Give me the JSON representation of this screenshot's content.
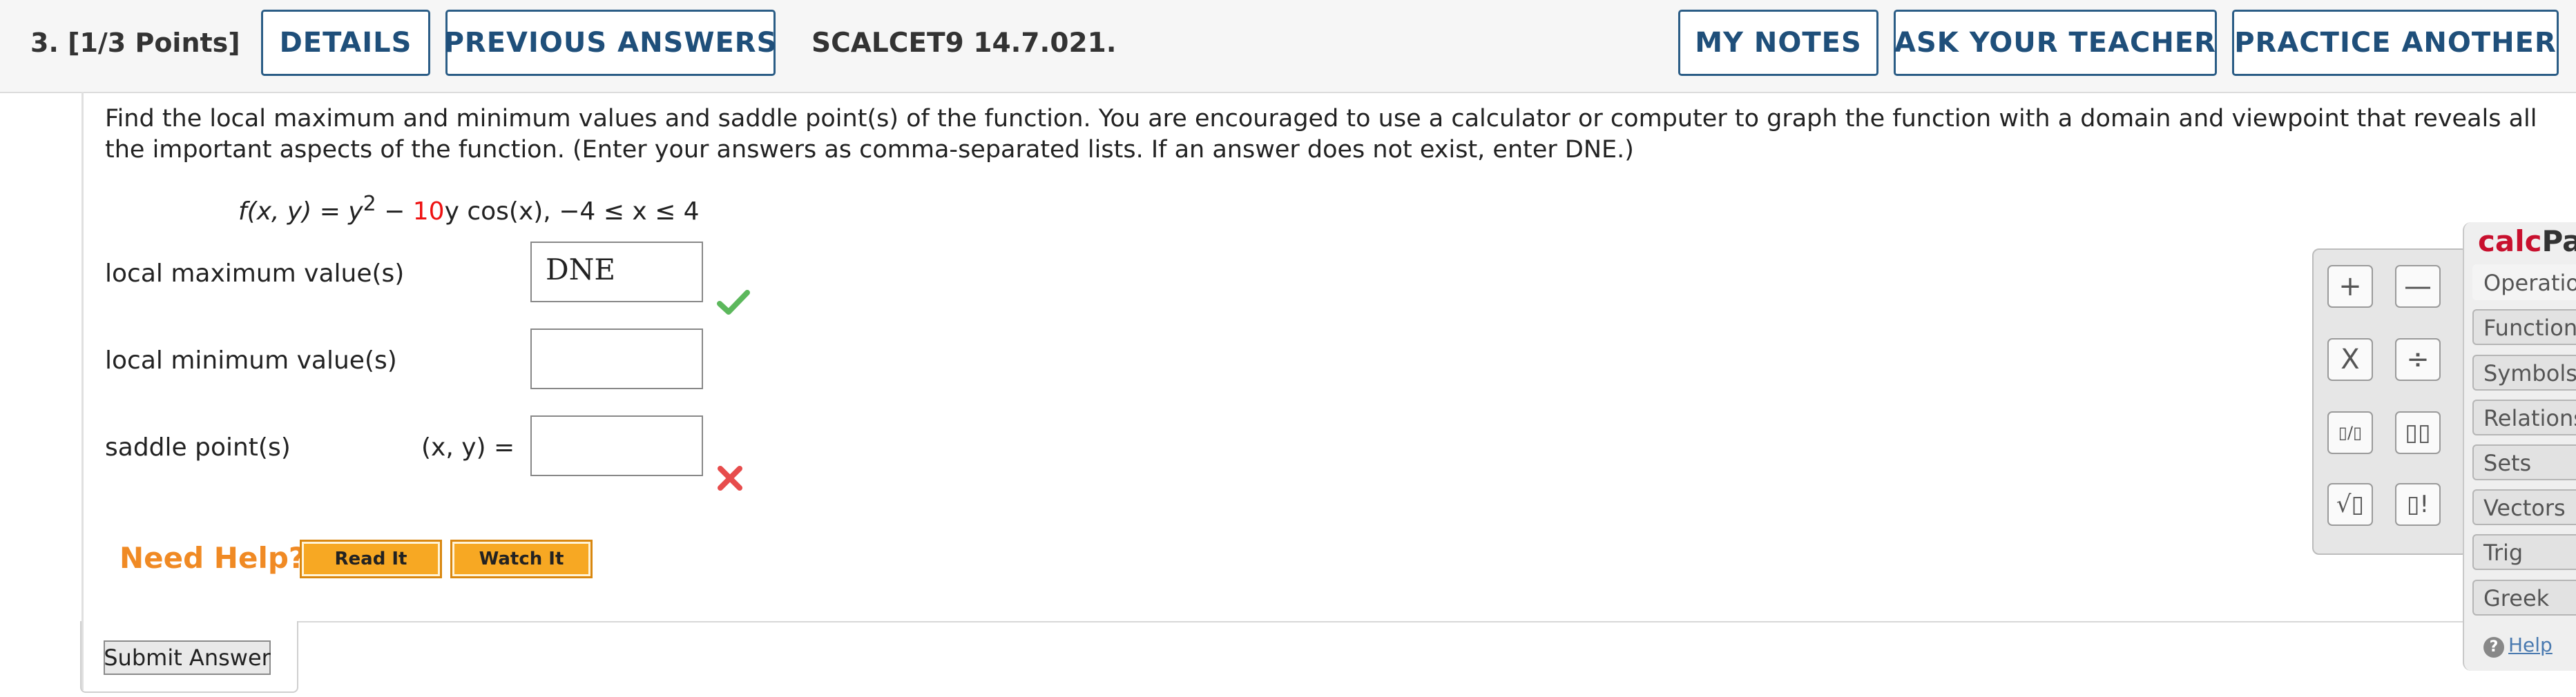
{
  "header": {
    "question": "3.  [1/3 Points]",
    "details": "DETAILS",
    "previous_answers": "PREVIOUS ANSWERS",
    "reference": "SCALCET9 14.7.021.",
    "my_notes": "MY NOTES",
    "ask_teacher": "ASK YOUR TEACHER",
    "practice_another": "PRACTICE ANOTHER"
  },
  "question": {
    "prompt": "Find the local maximum and minimum values and saddle point(s) of the function. You are encouraged to use a calculator or computer to graph the function with a domain and viewpoint that reveals all the important aspects of the function. (Enter your answers as comma-separated lists. If an answer does not exist, enter DNE.)",
    "formula_pre": "f(x, y) = y",
    "formula_exp": "2",
    "formula_mid": " − ",
    "formula_coef": "10",
    "formula_post": "y cos(x),   −4 ≤ x ≤ 4"
  },
  "answers": {
    "local_max_label": "local maximum value(s)",
    "local_max_value": "DNE",
    "local_max_status": "correct",
    "local_min_label": "local minimum value(s)",
    "local_min_value": "",
    "saddle_label": "saddle point(s)",
    "saddle_prefix": "(x, y)  =",
    "saddle_value": "",
    "saddle_status": "incorrect"
  },
  "help": {
    "need_help": "Need Help?",
    "read_it": "Read It",
    "watch_it": "Watch It"
  },
  "submit_label": "Submit Answer",
  "calcpad": {
    "title_a": "calc",
    "title_b": "Pad",
    "keys": [
      "+",
      "—",
      "X",
      "÷",
      "▯/▯",
      "▯▯",
      "√▯",
      "▯!"
    ],
    "tabs": [
      "Operations",
      "Functions",
      "Symbols",
      "Relations",
      "Sets",
      "Vectors",
      "Trig",
      "Greek"
    ],
    "help": "Help"
  },
  "colors": {
    "button_border": "#2b5d86",
    "need_help": "#f08a24",
    "calcpad_brand": "#c8102e",
    "correct": "#5cb85c",
    "incorrect": "#e74c4c"
  }
}
